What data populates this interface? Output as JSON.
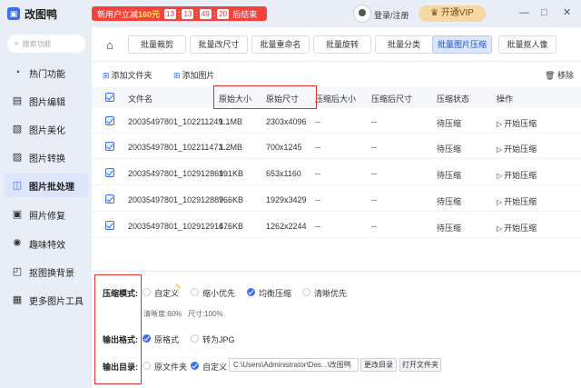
{
  "app": {
    "name": "改图鸭"
  },
  "promo": {
    "prefix": "新用户立减",
    "price": "160元",
    "h": "13",
    "m": "13",
    "s": "49",
    "ms": "20",
    "suffix": "后结束"
  },
  "user": {
    "login": "登录/注册",
    "vip": "开通VIP"
  },
  "window": {
    "min": "—",
    "max": "□",
    "close": "✕"
  },
  "sidebar": {
    "search_placeholder": "搜索功能",
    "items": [
      {
        "label": "热门功能",
        "icon": "hot-icon"
      },
      {
        "label": "图片编辑",
        "icon": "edit-icon"
      },
      {
        "label": "图片美化",
        "icon": "beautify-icon"
      },
      {
        "label": "图片转换",
        "icon": "convert-icon"
      },
      {
        "label": "图片批处理",
        "icon": "batch-icon",
        "active": true
      },
      {
        "label": "照片修复",
        "icon": "repair-icon"
      },
      {
        "label": "趣味特效",
        "icon": "effects-icon"
      },
      {
        "label": "抠图换背景",
        "icon": "cutout-icon"
      },
      {
        "label": "更多图片工具",
        "icon": "more-tools-icon"
      }
    ]
  },
  "tabs": [
    {
      "label": "批量裁剪"
    },
    {
      "label": "批量改尺寸"
    },
    {
      "label": "批量重命名"
    },
    {
      "label": "批量旋转"
    },
    {
      "label": "批量分类"
    },
    {
      "label": "批量图片压缩",
      "active": true
    },
    {
      "label": "批量抠人像"
    }
  ],
  "toolbar": {
    "add_folder": "添加文件夹",
    "add_image": "添加图片",
    "remove": "移除"
  },
  "table": {
    "headers": {
      "name": "文件名",
      "orig_size": "原始大小",
      "orig_dim": "原始尺寸",
      "comp_size": "压缩后大小",
      "comp_dim": "压缩后尺寸",
      "status": "压缩状态",
      "action": "操作"
    },
    "rows": [
      {
        "name": "20035497801_102211249...",
        "size": "1.1MB",
        "dim": "2303x4096",
        "csize": "--",
        "cdim": "--",
        "status": "待压缩",
        "action": "开始压缩"
      },
      {
        "name": "20035497801_102211473...",
        "size": "1.2MB",
        "dim": "700x1245",
        "csize": "--",
        "cdim": "--",
        "status": "待压缩",
        "action": "开始压缩"
      },
      {
        "name": "20035497801_102912869...",
        "size": "191KB",
        "dim": "653x1160",
        "csize": "--",
        "cdim": "--",
        "status": "待压缩",
        "action": "开始压缩"
      },
      {
        "name": "20035497801_102912889...",
        "size": "766KB",
        "dim": "1929x3429",
        "csize": "--",
        "cdim": "--",
        "status": "待压缩",
        "action": "开始压缩"
      },
      {
        "name": "20035497801_102912914...",
        "size": "676KB",
        "dim": "1262x2244",
        "csize": "--",
        "cdim": "--",
        "status": "待压缩",
        "action": "开始压缩"
      }
    ]
  },
  "settings": {
    "mode_label": "压缩模式:",
    "modes": [
      "自定义",
      "缩小优先",
      "均衡压缩",
      "清晰优先"
    ],
    "clarity": "清晰度:60%",
    "size": "尺寸:100%",
    "format_label": "输出格式:",
    "formats": [
      "原格式",
      "转为JPG"
    ],
    "dir_label": "输出目录:",
    "dirs": [
      "原文件夹",
      "自定义"
    ],
    "path": "C:\\Users\\Administrator\\Des...\\改图鸭",
    "change_dir": "更改目录",
    "open_folder": "打开文件夹"
  },
  "colors": {
    "accent": "#3b6ef5",
    "highlight": "#e0322c",
    "promo": "#f5433c"
  }
}
